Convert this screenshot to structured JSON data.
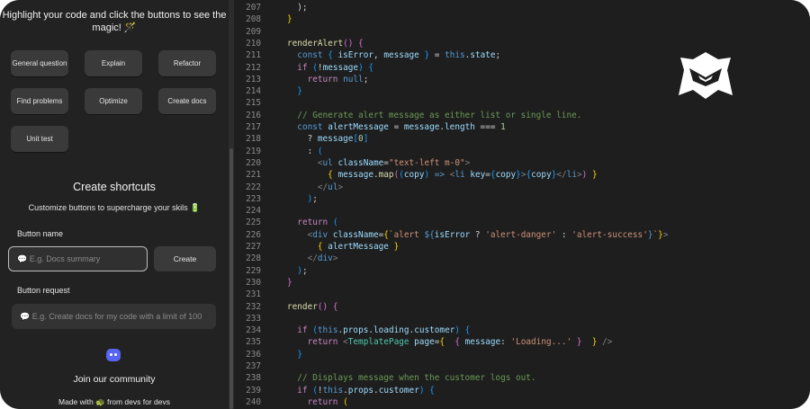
{
  "sidebar": {
    "intro": "Highlight your code and click the buttons to see the magic! 🪄",
    "quick_buttons": [
      {
        "label": "General question"
      },
      {
        "label": "Explain"
      },
      {
        "label": "Refactor"
      },
      {
        "label": "Find problems"
      },
      {
        "label": "Optimize"
      },
      {
        "label": "Create docs"
      },
      {
        "label": "Unit test"
      }
    ],
    "create_heading": "Create shortcuts",
    "create_subtitle": "Customize buttons to supercharge your skils 🔋",
    "button_name_label": "Button name",
    "button_name_placeholder": "💬 E.g. Docs summary",
    "create_button": "Create",
    "button_request_label": "Button request",
    "button_request_placeholder": "💬 E.g. Create docs for my code with a limit of 100",
    "join": "Join our community",
    "made_with": "Made with 🐢 from devs for devs"
  },
  "editor": {
    "lines": [
      {
        "n": "207",
        "html": "<span class=\"plain\">  );</span>"
      },
      {
        "n": "208",
        "html": "<span class=\"br\">}</span>"
      },
      {
        "n": "209",
        "html": ""
      },
      {
        "n": "210",
        "html": "<span class=\"fn\">renderAlert</span><span class=\"br2\">()</span> <span class=\"br2\">{</span>"
      },
      {
        "n": "211",
        "html": "  <span class=\"kw\">const</span> <span class=\"br3\">{</span> <span class=\"var\">isError</span>, <span class=\"var\">message</span> <span class=\"br3\">}</span> = <span class=\"kw\">this</span>.<span class=\"var\">state</span>;"
      },
      {
        "n": "212",
        "html": "  <span class=\"ctrl\">if</span> <span class=\"br3\">(</span>!<span class=\"var\">message</span><span class=\"br3\">)</span> <span class=\"br3\">{</span>"
      },
      {
        "n": "213",
        "html": "    <span class=\"ctrl\">return</span> <span class=\"kw\">null</span>;"
      },
      {
        "n": "214",
        "html": "  <span class=\"br3\">}</span>"
      },
      {
        "n": "215",
        "html": ""
      },
      {
        "n": "216",
        "html": "  <span class=\"cmt\">// Generate alert message as either list or single line.</span>"
      },
      {
        "n": "217",
        "html": "  <span class=\"kw\">const</span> <span class=\"var\">alertMessage</span> = <span class=\"var\">message</span>.<span class=\"var\">length</span> === <span class=\"num\">1</span>"
      },
      {
        "n": "218",
        "html": "    ? <span class=\"var\">message</span><span class=\"br3\">[</span><span class=\"num\">0</span><span class=\"br3\">]</span>"
      },
      {
        "n": "219",
        "html": "    : <span class=\"br3\">(</span>"
      },
      {
        "n": "220",
        "html": "      <span class=\"gray\">&lt;</span><span class=\"kw\">ul</span> <span class=\"var\">className</span>=<span class=\"str\">\"text-left m-0\"</span><span class=\"gray\">&gt;</span>"
      },
      {
        "n": "221",
        "html": "        <span class=\"br\">{</span> <span class=\"var\">message</span>.<span class=\"fn\">map</span><span class=\"br2\">(</span><span class=\"br3\">(</span><span class=\"var\">copy</span><span class=\"br3\">)</span> <span class=\"kw\">=&gt;</span> <span class=\"gray\">&lt;</span><span class=\"kw\">li</span> <span class=\"var\">key</span>=<span class=\"br3\">{</span><span class=\"var\">copy</span><span class=\"br3\">}</span><span class=\"gray\">&gt;</span><span class=\"br3\">{</span><span class=\"var\">copy</span><span class=\"br3\">}</span><span class=\"gray\">&lt;/</span><span class=\"kw\">li</span><span class=\"gray\">&gt;</span><span class=\"br2\">)</span> <span class=\"br\">}</span>"
      },
      {
        "n": "222",
        "html": "      <span class=\"gray\">&lt;/</span><span class=\"kw\">ul</span><span class=\"gray\">&gt;</span>"
      },
      {
        "n": "223",
        "html": "    <span class=\"br3\">)</span>;"
      },
      {
        "n": "224",
        "html": ""
      },
      {
        "n": "225",
        "html": "  <span class=\"ctrl\">return</span> <span class=\"br3\">(</span>"
      },
      {
        "n": "226",
        "html": "    <span class=\"gray\">&lt;</span><span class=\"kw\">div</span> <span class=\"var\">className</span>=<span class=\"br\">{</span><span class=\"str\">`alert </span><span class=\"kw\">${</span><span class=\"var\">isError</span> ? <span class=\"str\">'alert-danger'</span> : <span class=\"str\">'alert-success'</span><span class=\"kw\">}</span><span class=\"str\">`</span><span class=\"br\">}</span><span class=\"gray\">&gt;</span>"
      },
      {
        "n": "227",
        "html": "      <span class=\"br\">{</span> <span class=\"var\">alertMessage</span> <span class=\"br\">}</span>"
      },
      {
        "n": "228",
        "html": "    <span class=\"gray\">&lt;/</span><span class=\"kw\">div</span><span class=\"gray\">&gt;</span>"
      },
      {
        "n": "229",
        "html": "  <span class=\"br3\">)</span>;"
      },
      {
        "n": "230",
        "html": "<span class=\"br2\">}</span>"
      },
      {
        "n": "231",
        "html": ""
      },
      {
        "n": "232",
        "html": "<span class=\"fn\">render</span><span class=\"br2\">()</span> <span class=\"br2\">{</span>"
      },
      {
        "n": "233",
        "html": ""
      },
      {
        "n": "234",
        "html": "  <span class=\"ctrl\">if</span> <span class=\"br3\">(</span><span class=\"kw\">this</span>.<span class=\"var\">props</span>.<span class=\"var\">loading</span>.<span class=\"var\">customer</span><span class=\"br3\">)</span> <span class=\"br3\">{</span>"
      },
      {
        "n": "235",
        "html": "    <span class=\"ctrl\">return</span> <span class=\"gray\">&lt;</span><span class=\"tag\">TemplatePage</span> <span class=\"var\">page</span>=<span class=\"br\">{</span>  <span class=\"br2\">{</span> <span class=\"var\">message</span>: <span class=\"str\">'Loading...'</span> <span class=\"br2\">}</span>  <span class=\"br\">}</span> <span class=\"gray\">/&gt;</span>"
      },
      {
        "n": "236",
        "html": "  <span class=\"br3\">}</span>"
      },
      {
        "n": "237",
        "html": ""
      },
      {
        "n": "238",
        "html": "  <span class=\"cmt\">// Displays message when the customer logs out.</span>"
      },
      {
        "n": "239",
        "html": "  <span class=\"ctrl\">if</span> <span class=\"br3\">(</span>!<span class=\"kw\">this</span>.<span class=\"var\">props</span>.<span class=\"var\">customer</span><span class=\"br3\">)</span> <span class=\"br3\">{</span>"
      },
      {
        "n": "240",
        "html": "    <span class=\"ctrl\">return</span> <span class=\"br\">(</span>"
      }
    ]
  },
  "colors": {
    "background": "#1e1e1e",
    "sidebar": "#222222",
    "button": "#3a3a3a",
    "discord": "#5865f2"
  },
  "icons": [
    "chat-bubble-icon",
    "discord-icon",
    "shield-logo-icon"
  ]
}
